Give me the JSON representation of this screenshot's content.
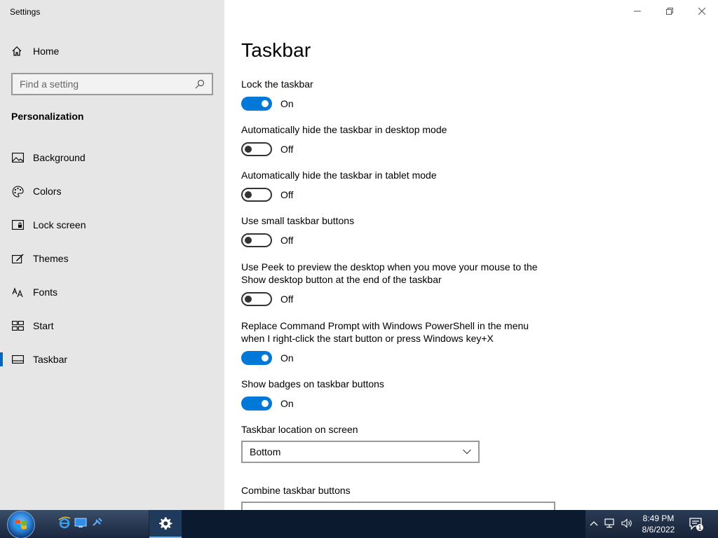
{
  "app": {
    "title": "Settings"
  },
  "sidebar": {
    "home_label": "Home",
    "search_placeholder": "Find a setting",
    "section_title": "Personalization",
    "items": [
      {
        "label": "Background",
        "icon": "image-icon"
      },
      {
        "label": "Colors",
        "icon": "palette-icon"
      },
      {
        "label": "Lock screen",
        "icon": "lock-screen-icon"
      },
      {
        "label": "Themes",
        "icon": "themes-icon"
      },
      {
        "label": "Fonts",
        "icon": "fonts-icon"
      },
      {
        "label": "Start",
        "icon": "start-icon"
      },
      {
        "label": "Taskbar",
        "icon": "taskbar-icon",
        "active": true
      }
    ]
  },
  "main": {
    "title": "Taskbar",
    "settings": [
      {
        "label": "Lock the taskbar",
        "state": "On"
      },
      {
        "label": "Automatically hide the taskbar in desktop mode",
        "state": "Off"
      },
      {
        "label": "Automatically hide the taskbar in tablet mode",
        "state": "Off"
      },
      {
        "label": "Use small taskbar buttons",
        "state": "Off"
      },
      {
        "label": "Use Peek to preview the desktop when you move your mouse to the Show desktop button at the end of the taskbar",
        "state": "Off"
      },
      {
        "label": "Replace Command Prompt with Windows PowerShell in the menu when I right-click the start button or press Windows key+X",
        "state": "On"
      },
      {
        "label": "Show badges on taskbar buttons",
        "state": "On"
      }
    ],
    "location_label": "Taskbar location on screen",
    "location_value": "Bottom",
    "combine_label": "Combine taskbar buttons"
  },
  "taskbar": {
    "time": "8:49 PM",
    "date": "8/6/2022",
    "notification_count": "1"
  },
  "colors": {
    "accent": "#0078d7",
    "sidebar_bg": "#e6e6e6"
  }
}
